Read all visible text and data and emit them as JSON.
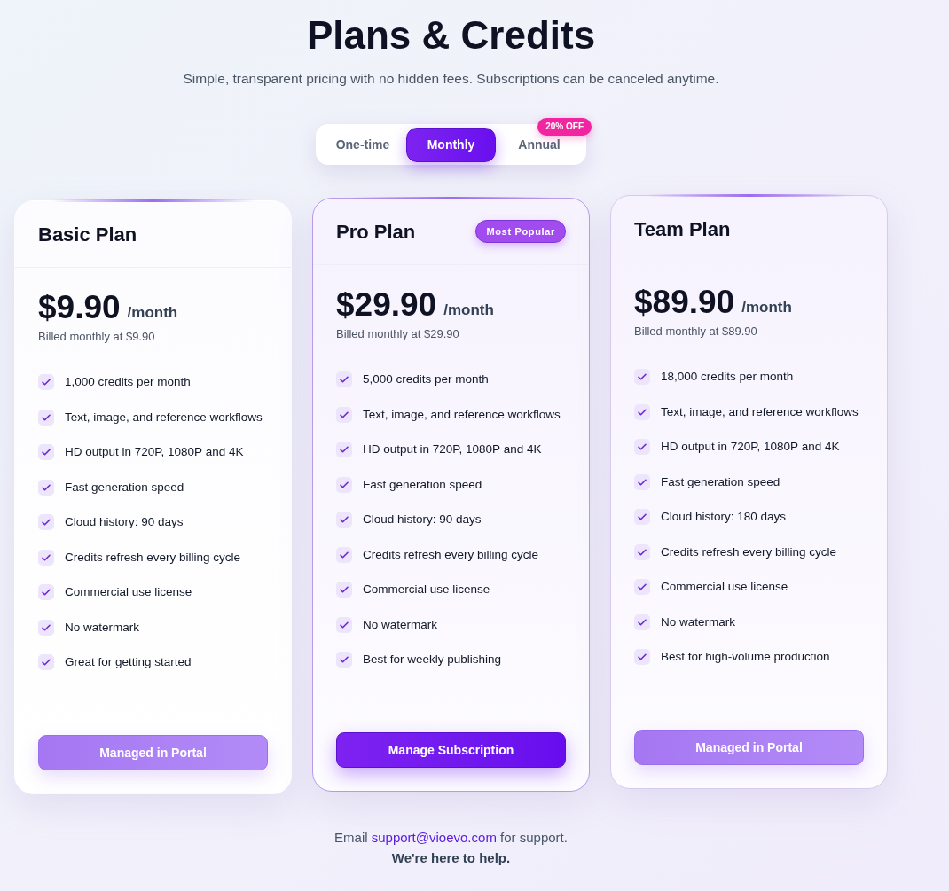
{
  "header": {
    "title": "Plans & Credits",
    "subtitle": "Simple, transparent pricing with no hidden fees. Subscriptions can be canceled anytime."
  },
  "billing_toggle": [
    {
      "label": "One-time",
      "selected": false
    },
    {
      "label": "Monthly",
      "selected": true
    },
    {
      "label": "Annual",
      "selected": false,
      "badge": "20% OFF"
    }
  ],
  "plans": [
    {
      "name": "Basic Plan",
      "highlighted": false,
      "hovered": false,
      "price": "$9.90",
      "period": "/month",
      "billed": "Billed monthly at $9.90",
      "features": [
        "1,000 credits per month",
        "Text, image, and reference workflows",
        "HD output in 720P, 1080P and 4K",
        "Fast generation speed",
        "Cloud history: 90 days",
        "Credits refresh every billing cycle",
        "Commercial use license",
        "No watermark",
        "Great for getting started"
      ],
      "button": {
        "label": "Managed in Portal",
        "kind": "muted"
      }
    },
    {
      "name": "Pro Plan",
      "badge": "Most Popular",
      "highlighted": true,
      "hovered": false,
      "price": "$29.90",
      "period": "/month",
      "billed": "Billed monthly at $29.90",
      "features": [
        "5,000 credits per month",
        "Text, image, and reference workflows",
        "HD output in 720P, 1080P and 4K",
        "Fast generation speed",
        "Cloud history: 90 days",
        "Credits refresh every billing cycle",
        "Commercial use license",
        "No watermark",
        "Best for weekly publishing"
      ],
      "button": {
        "label": "Manage Subscription",
        "kind": "primary"
      }
    },
    {
      "name": "Team Plan",
      "highlighted": false,
      "hovered": true,
      "price": "$89.90",
      "period": "/month",
      "billed": "Billed monthly at $89.90",
      "features": [
        "18,000 credits per month",
        "Text, image, and reference workflows",
        "HD output in 720P, 1080P and 4K",
        "Fast generation speed",
        "Cloud history: 180 days",
        "Credits refresh every billing cycle",
        "Commercial use license",
        "No watermark",
        "Best for high-volume production"
      ],
      "button": {
        "label": "Managed in Portal",
        "kind": "muted"
      }
    }
  ],
  "footer": {
    "text_before": "Email",
    "link": "support@vioevo.com",
    "text_after": "for support.",
    "note": "We're here to help."
  }
}
